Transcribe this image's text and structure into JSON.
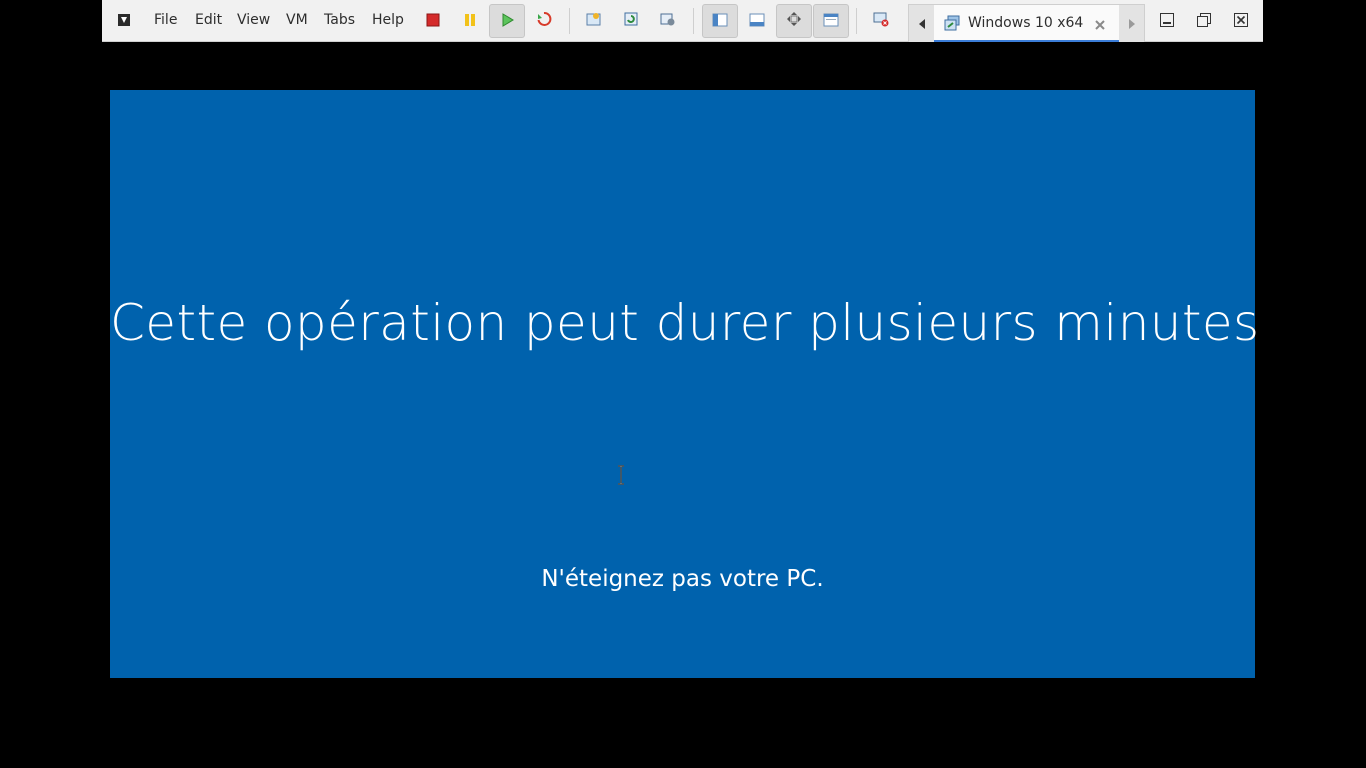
{
  "menu": {
    "file": "File",
    "edit": "Edit",
    "view": "View",
    "vm": "VM",
    "tabs": "Tabs",
    "help": "Help"
  },
  "tab": {
    "title": "Windows 10 x64"
  },
  "vm_screen": {
    "message": "Cette opération peut durer plusieurs minutes",
    "submessage": "N'éteignez pas votre PC.",
    "background_color": "#0062ad"
  },
  "icons": {
    "pin": "pin-icon",
    "power_off": "power-off-icon",
    "suspend": "suspend-icon",
    "power_on": "power-on-icon",
    "reset": "reset-icon",
    "snapshot": "snapshot-icon",
    "revert": "revert-snapshot-icon",
    "snapshot_manager": "snapshot-manager-icon",
    "sidebar": "sidebar-icon",
    "thumbnail": "thumbnail-bar-icon",
    "fullscreen": "fullscreen-icon",
    "unity": "unity-icon",
    "disconnect": "disconnect-icon",
    "minimize": "minimize-icon",
    "maximize": "maximize-icon",
    "close": "close-icon"
  }
}
